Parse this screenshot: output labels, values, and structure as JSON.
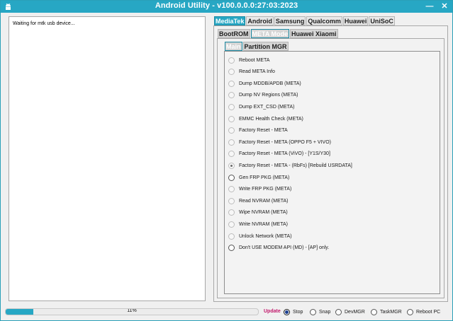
{
  "window": {
    "title": "Android Utility - v100.0.0.0:27:03:2023",
    "minimize_glyph": "—",
    "close_glyph": "✕",
    "icon": "android-icon",
    "accent": "#27a7c4"
  },
  "log": {
    "message": "Waiting for mtk usb device..."
  },
  "vendor_tabs": [
    {
      "label": "MediaTek",
      "active": true
    },
    {
      "label": "Android",
      "active": false
    },
    {
      "label": "Samsung",
      "active": false
    },
    {
      "label": "Qualcomm",
      "active": false
    },
    {
      "label": "Huawei",
      "active": false
    },
    {
      "label": "UniSoC",
      "active": false
    }
  ],
  "mode_tabs": [
    {
      "label": "BootROM",
      "active": false
    },
    {
      "label": "META Mode",
      "active": true
    },
    {
      "label": "Huawei Xiaomi",
      "active": false
    }
  ],
  "sub_tabs": [
    {
      "label": "Main",
      "active": true
    },
    {
      "label": "Partition MGR",
      "active": false
    }
  ],
  "options": [
    {
      "label": "Reboot META",
      "selected": false
    },
    {
      "label": "Read META Info",
      "selected": false
    },
    {
      "label": "Dump MDDB/APDB (META)",
      "selected": false
    },
    {
      "label": "Dump NV Regions (META)",
      "selected": false
    },
    {
      "label": "Dump  EXT_CSD (META)",
      "selected": false
    },
    {
      "label": "EMMC Health Check (META)",
      "selected": false
    },
    {
      "label": "Factory Reset - META",
      "selected": false
    },
    {
      "label": "Factory Reset - META (OPPO F5 + VIVO)",
      "selected": false
    },
    {
      "label": "Factory Reset - META (ViVO) - [Y1S/Y30]",
      "selected": false
    },
    {
      "label": "Factory Reset - META - (RbFs) [Rebuild USRDATA]",
      "selected": true
    },
    {
      "label": "Gen FRP PKG (META)",
      "selected": false
    },
    {
      "label": "Write FRP PKG (META)",
      "selected": false
    },
    {
      "label": "Read NVRAM (META)",
      "selected": false
    },
    {
      "label": "Wipe NVRAM (META)",
      "selected": false
    },
    {
      "label": "Write NVRAM (META)",
      "selected": false
    },
    {
      "label": "Unlock Network (META)",
      "selected": false
    },
    {
      "label": "Don't USE MODEM API (MD) - [AP] only.",
      "selected": false
    }
  ],
  "progress": {
    "value": 0.11,
    "text": "11%"
  },
  "footer": {
    "update_label": "Update",
    "update_color": "#c2186b",
    "options": [
      {
        "label": "Stop",
        "selected": true
      },
      {
        "label": "Snap",
        "selected": false
      },
      {
        "label": "DevMGR",
        "selected": false
      },
      {
        "label": "TaskMGR",
        "selected": false
      },
      {
        "label": "Reboot PC",
        "selected": false
      }
    ]
  }
}
